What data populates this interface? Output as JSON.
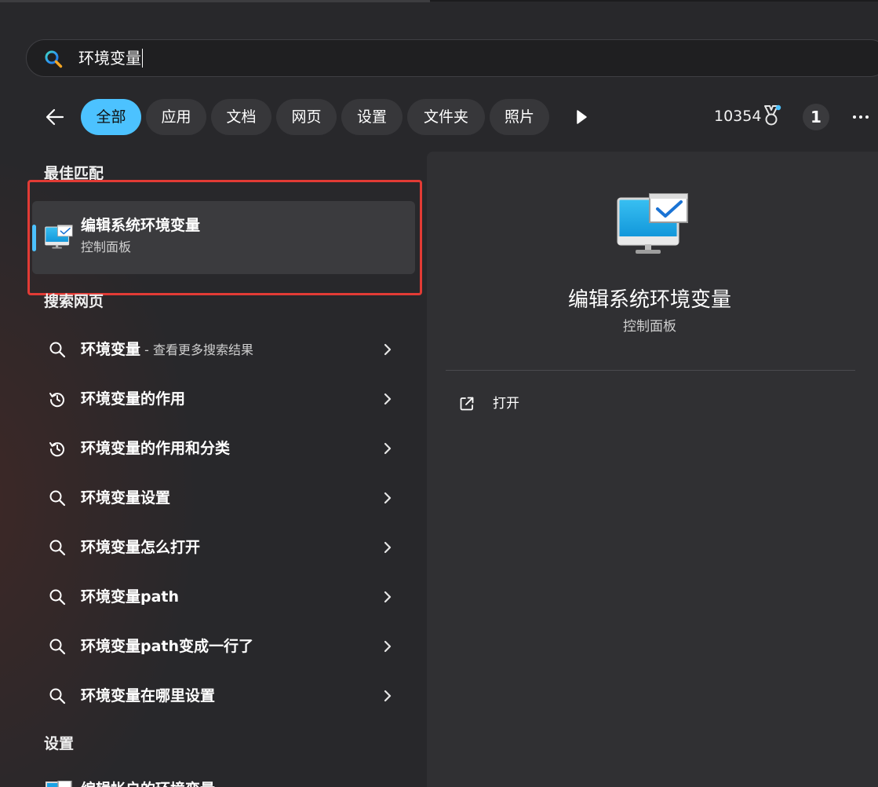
{
  "search": {
    "query": "环境变量"
  },
  "filters": {
    "chips": [
      {
        "label": "全部",
        "active": true
      },
      {
        "label": "应用"
      },
      {
        "label": "文档"
      },
      {
        "label": "网页"
      },
      {
        "label": "设置"
      },
      {
        "label": "文件夹"
      },
      {
        "label": "照片"
      }
    ],
    "points": "10354",
    "badge": "1"
  },
  "best_match": {
    "section_title": "最佳匹配",
    "title": "编辑系统环境变量",
    "subtitle": "控制面板"
  },
  "web_search": {
    "section_title": "搜索网页",
    "items": [
      {
        "text": "环境变量",
        "suffix": " - 查看更多搜索结果",
        "icon": "search-icon"
      },
      {
        "text": "环境变量的作用",
        "icon": "history-icon"
      },
      {
        "text": "环境变量的作用和分类",
        "icon": "history-icon"
      },
      {
        "text": "环境变量设置",
        "icon": "search-icon"
      },
      {
        "text": "环境变量怎么打开",
        "icon": "search-icon"
      },
      {
        "text": "环境变量path",
        "icon": "search-icon"
      },
      {
        "text": "环境变量path变成一行了",
        "icon": "search-icon"
      },
      {
        "text": "环境变量在哪里设置",
        "icon": "search-icon"
      }
    ]
  },
  "settings": {
    "section_title": "设置",
    "item_text": "编辑帐户的环境变量"
  },
  "detail": {
    "title": "编辑系统环境变量",
    "subtitle": "控制面板",
    "actions": [
      {
        "label": "打开",
        "icon": "open-external-icon"
      }
    ]
  },
  "colors": {
    "accent": "#4cc2ff",
    "highlight": "#e23b35"
  }
}
